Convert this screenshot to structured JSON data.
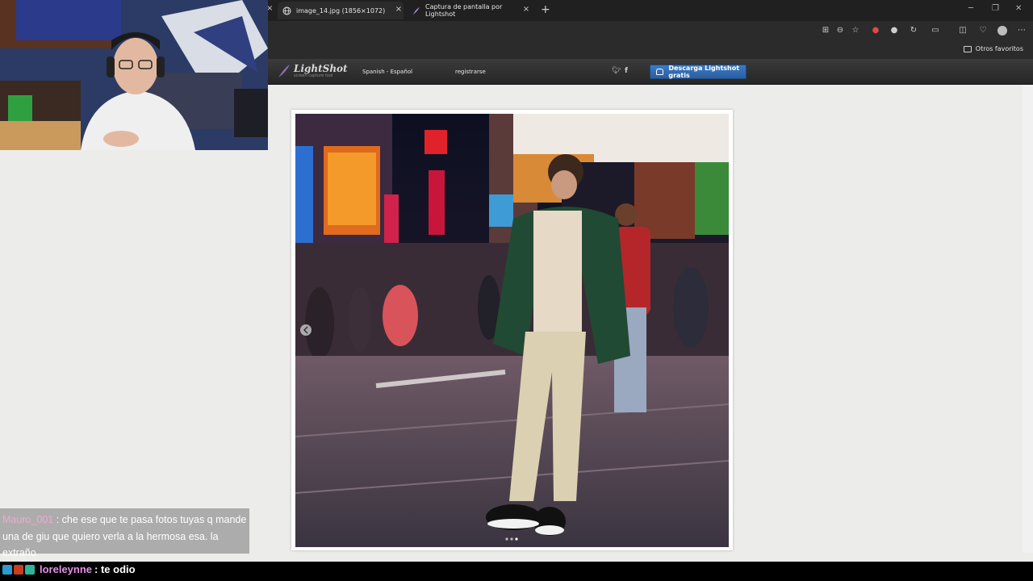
{
  "tabs": [
    {
      "label": "image_14.jpg (1856×1072)"
    },
    {
      "label": "Captura de pantalla por Lightshot"
    }
  ],
  "favorites": {
    "folder_label": "Otros favoritos"
  },
  "lightshot": {
    "logo_text": "LightShot",
    "logo_sub": "screen capture tool",
    "language": "Spanish - Español",
    "register": "registrarse",
    "download_label": "Descarga Lightshot gratis"
  },
  "chat": {
    "msg1_user": "Mauro_001",
    "msg1_text": ": che ese que te pasa fotos tuyas q mande una de giu que quiero verla a la hermosa esa. la extraño",
    "msg2_user": "loreleynne",
    "msg2_text": ": te odio"
  },
  "colors": {
    "download_button": "#2f68ad",
    "chat_user1": "#f0a9cf",
    "chat_user2": "#e58fe8"
  }
}
